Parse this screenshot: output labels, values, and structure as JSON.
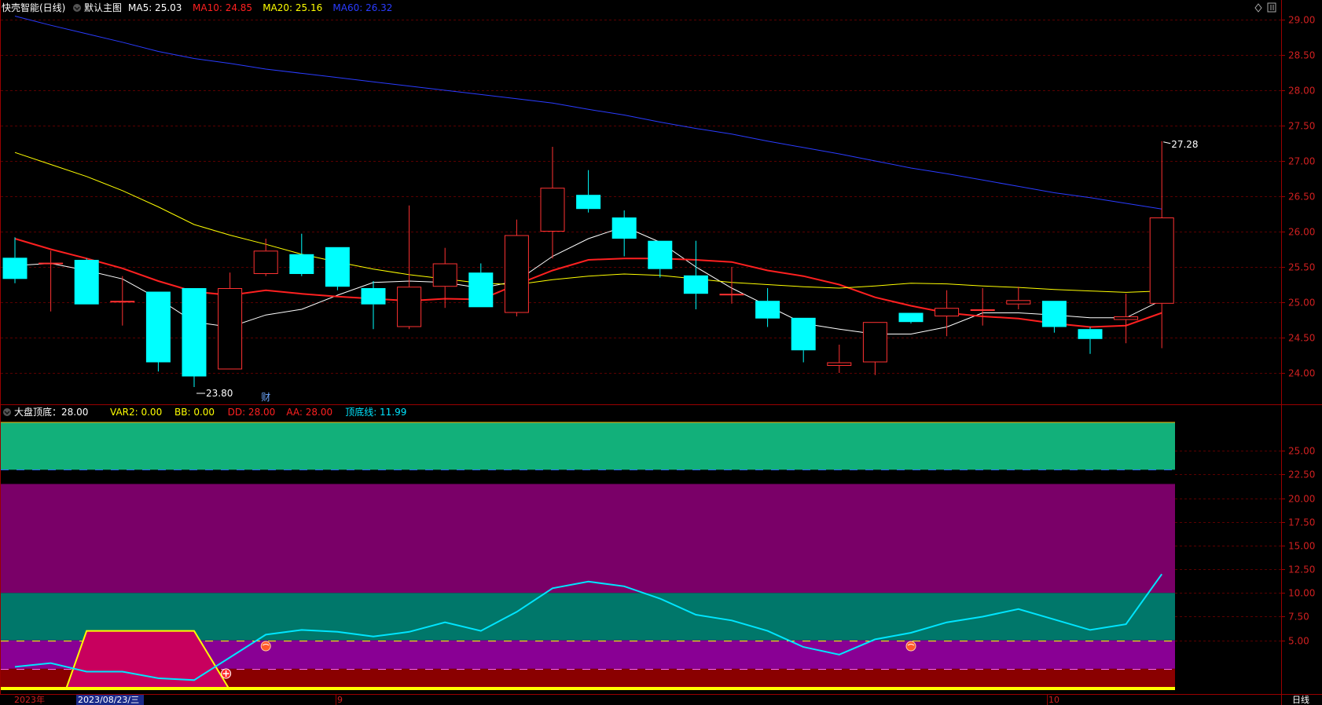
{
  "main_panel": {
    "stock": "快壳智能(日线)",
    "template": "默认主图",
    "indicators": [
      {
        "label": "MA5: 25.03",
        "color": "#ffffff"
      },
      {
        "label": "MA10: 24.85",
        "color": "#ff2020"
      },
      {
        "label": "MA20: 25.16",
        "color": "#ffff00"
      },
      {
        "label": "MA60: 26.32",
        "color": "#2a3cff"
      }
    ],
    "high_marker": "27.28",
    "low_marker": "23.80",
    "finance_marker": "财",
    "corner_icons": [
      "diamond-icon",
      "pause-icon"
    ]
  },
  "sub_panel": {
    "name": "大盘顶底：28.00",
    "indicators": [
      {
        "label": "VAR2: 0.00",
        "color": "#ffff00"
      },
      {
        "label": "BB: 0.00",
        "color": "#ffff00"
      },
      {
        "label": "DD: 28.00",
        "color": "#ff2020"
      },
      {
        "label": "AA: 28.00",
        "color": "#ff2020"
      },
      {
        "label": "顶底线: 11.99",
        "color": "#00e5ff"
      }
    ]
  },
  "x_axis": {
    "labels": [
      "2023年",
      "2023/08/23/三",
      "9",
      "10"
    ],
    "period": "日线"
  },
  "chart_data": [
    {
      "type": "candlestick",
      "ylim": [
        24.0,
        29.0
      ],
      "ytick_labels": [
        "24.00",
        "24.50",
        "25.00",
        "25.50",
        "26.00",
        "26.50",
        "27.00",
        "27.50",
        "28.00",
        "28.50",
        "29.00"
      ],
      "candles": [
        {
          "o": 25.63,
          "h": 25.92,
          "l": 25.27,
          "c": 25.33
        },
        {
          "o": 25.56,
          "h": 25.73,
          "l": 24.87,
          "c": 25.56
        },
        {
          "o": 25.6,
          "h": 25.62,
          "l": 24.97,
          "c": 24.97
        },
        {
          "o": 25.02,
          "h": 25.37,
          "l": 24.67,
          "c": 25.02
        },
        {
          "o": 25.15,
          "h": 25.15,
          "l": 24.02,
          "c": 24.15
        },
        {
          "o": 25.2,
          "h": 25.2,
          "l": 23.8,
          "c": 23.95
        },
        {
          "o": 24.05,
          "h": 25.42,
          "l": 24.05,
          "c": 25.2
        },
        {
          "o": 25.4,
          "h": 25.9,
          "l": 25.37,
          "c": 25.73
        },
        {
          "o": 25.68,
          "h": 25.97,
          "l": 25.37,
          "c": 25.4
        },
        {
          "o": 25.78,
          "h": 25.78,
          "l": 25.17,
          "c": 25.22
        },
        {
          "o": 25.2,
          "h": 25.3,
          "l": 24.62,
          "c": 24.97
        },
        {
          "o": 24.65,
          "h": 26.37,
          "l": 24.62,
          "c": 25.22
        },
        {
          "o": 25.22,
          "h": 25.77,
          "l": 24.92,
          "c": 25.55
        },
        {
          "o": 25.42,
          "h": 25.55,
          "l": 24.93,
          "c": 24.93
        },
        {
          "o": 24.85,
          "h": 26.17,
          "l": 24.8,
          "c": 25.95
        },
        {
          "o": 26.0,
          "h": 27.2,
          "l": 25.62,
          "c": 26.62
        },
        {
          "o": 26.52,
          "h": 26.87,
          "l": 26.27,
          "c": 26.32
        },
        {
          "o": 26.2,
          "h": 26.3,
          "l": 25.65,
          "c": 25.9
        },
        {
          "o": 25.87,
          "h": 25.87,
          "l": 25.35,
          "c": 25.47
        },
        {
          "o": 25.38,
          "h": 25.87,
          "l": 24.9,
          "c": 25.12
        },
        {
          "o": 25.12,
          "h": 25.5,
          "l": 24.98,
          "c": 25.12
        },
        {
          "o": 25.02,
          "h": 25.2,
          "l": 24.65,
          "c": 24.77
        },
        {
          "o": 24.78,
          "h": 24.78,
          "l": 24.15,
          "c": 24.32
        },
        {
          "o": 24.1,
          "h": 24.4,
          "l": 24.0,
          "c": 24.15
        },
        {
          "o": 24.15,
          "h": 24.72,
          "l": 23.97,
          "c": 24.72
        },
        {
          "o": 24.85,
          "h": 24.85,
          "l": 24.7,
          "c": 24.72
        },
        {
          "o": 24.8,
          "h": 25.17,
          "l": 24.52,
          "c": 24.92
        },
        {
          "o": 24.9,
          "h": 25.2,
          "l": 24.67,
          "c": 24.9
        },
        {
          "o": 24.97,
          "h": 25.22,
          "l": 24.9,
          "c": 25.03
        },
        {
          "o": 25.02,
          "h": 25.02,
          "l": 24.57,
          "c": 24.65
        },
        {
          "o": 24.62,
          "h": 24.65,
          "l": 24.27,
          "c": 24.48
        },
        {
          "o": 24.75,
          "h": 25.12,
          "l": 24.42,
          "c": 24.8
        },
        {
          "o": 24.98,
          "h": 27.28,
          "l": 24.35,
          "c": 26.2
        }
      ],
      "series": [
        {
          "name": "MA5",
          "color": "#ffffff",
          "values": [
            25.52,
            25.55,
            25.45,
            25.33,
            25.05,
            24.72,
            24.65,
            24.82,
            24.9,
            25.1,
            25.28,
            25.3,
            25.28,
            25.2,
            25.3,
            25.65,
            25.9,
            26.07,
            25.85,
            25.5,
            25.2,
            24.95,
            24.7,
            24.62,
            24.55,
            24.55,
            24.65,
            24.85,
            24.85,
            24.82,
            24.78,
            24.78,
            25.03
          ]
        },
        {
          "name": "MA10",
          "color": "#ff2020",
          "values": [
            25.9,
            25.75,
            25.62,
            25.48,
            25.3,
            25.15,
            25.1,
            25.17,
            25.12,
            25.08,
            25.05,
            25.02,
            25.05,
            25.04,
            25.25,
            25.45,
            25.6,
            25.62,
            25.62,
            25.6,
            25.57,
            25.45,
            25.37,
            25.25,
            25.07,
            24.95,
            24.85,
            24.8,
            24.77,
            24.7,
            24.65,
            24.67,
            24.85
          ]
        },
        {
          "name": "MA20",
          "color": "#ffff00",
          "values": [
            27.12,
            26.95,
            26.78,
            26.58,
            26.35,
            26.1,
            25.95,
            25.82,
            25.68,
            25.57,
            25.47,
            25.39,
            25.33,
            25.27,
            25.25,
            25.32,
            25.37,
            25.4,
            25.38,
            25.33,
            25.28,
            25.25,
            25.22,
            25.2,
            25.23,
            25.27,
            25.26,
            25.23,
            25.21,
            25.18,
            25.16,
            25.14,
            25.16
          ]
        },
        {
          "name": "MA60",
          "color": "#2a3cff",
          "values": [
            29.05,
            28.92,
            28.8,
            28.68,
            28.55,
            28.45,
            28.38,
            28.3,
            28.24,
            28.18,
            28.12,
            28.06,
            28.0,
            27.94,
            27.88,
            27.82,
            27.73,
            27.65,
            27.55,
            27.46,
            27.38,
            27.28,
            27.19,
            27.1,
            27.0,
            26.9,
            26.82,
            26.73,
            26.64,
            26.55,
            26.48,
            26.4,
            26.32
          ]
        }
      ]
    },
    {
      "type": "line",
      "ylim": [
        0,
        28.0
      ],
      "ytick_labels": [
        "5.00",
        "7.50",
        "10.00",
        "12.50",
        "15.00",
        "17.50",
        "20.00",
        "22.50",
        "25.00"
      ],
      "bands": [
        {
          "from": 23.0,
          "to": 28.0,
          "color": "#12b07a"
        },
        {
          "from": 10.0,
          "to": 21.5,
          "color": "#7a0068"
        },
        {
          "from": 5.0,
          "to": 10.0,
          "color": "#00776a"
        },
        {
          "from": 2.0,
          "to": 5.0,
          "color": "#890094"
        },
        {
          "from": 0.0,
          "to": 2.0,
          "color": "#8a0000"
        }
      ],
      "reference_lines": [
        {
          "value": 23.0,
          "color": "#2c6ef2",
          "style": "dashed"
        },
        {
          "value": 5.0,
          "color": "#ffff00",
          "style": "dashed"
        },
        {
          "value": 2.0,
          "color": "#ff66ff",
          "style": "dashed"
        }
      ],
      "series": [
        {
          "name": "顶底线",
          "color": "#00e5ff",
          "values": [
            2.2,
            2.6,
            1.7,
            1.7,
            1.0,
            0.8,
            3.2,
            5.6,
            6.1,
            5.9,
            5.4,
            5.9,
            6.9,
            6.0,
            8.0,
            10.5,
            11.2,
            10.7,
            9.4,
            7.7,
            7.1,
            6.0,
            4.3,
            3.5,
            5.1,
            5.8,
            6.9,
            7.5,
            8.3,
            7.2,
            6.1,
            6.7,
            11.99
          ]
        },
        {
          "name": "DD",
          "color": "#ffff00",
          "values": [
            0,
            0,
            6.0,
            6.0,
            6.0,
            6.0,
            0,
            0,
            0,
            0,
            0,
            0,
            0,
            0,
            0,
            0,
            0,
            0,
            0,
            0,
            0,
            0,
            0,
            0,
            0,
            0,
            0,
            0,
            0,
            0,
            0,
            0,
            0
          ]
        }
      ],
      "signal_markers": [
        {
          "index": 6,
          "type": "plus"
        },
        {
          "index": 7,
          "type": "ball"
        },
        {
          "index": 25,
          "type": "ball"
        }
      ]
    }
  ]
}
